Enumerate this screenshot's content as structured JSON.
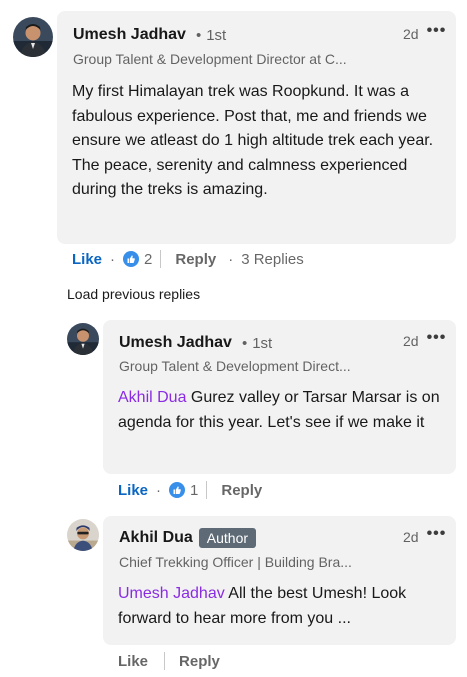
{
  "comments": [
    {
      "author": "Umesh Jadhav",
      "degree": "1st",
      "headline": "Group Talent & Development Director at C...",
      "time": "2d",
      "body": "My first Himalayan trek was Roopkund. It was a fabulous experience. Post that, me and friends we ensure we atleast do 1 high altitude trek each year. The peace, serenity and calmness experienced during the treks is amazing.",
      "like_label": "Like",
      "reaction_count": "2",
      "reply_label": "Reply",
      "replies_label": "3 Replies"
    },
    {
      "author": "Umesh Jadhav",
      "degree": "1st",
      "headline": "Group Talent & Development Direct...",
      "time": "2d",
      "mention": "Akhil Dua",
      "body": " Gurez valley or Tarsar Marsar is on agenda for this year. Let's see if we make it",
      "like_label": "Like",
      "reaction_count": "1",
      "reply_label": "Reply"
    },
    {
      "author": "Akhil Dua",
      "badge": "Author",
      "headline": "Chief Trekking Officer | Building Bra...",
      "time": "2d",
      "mention": "Umesh Jadhav",
      "body": " All the best Umesh! Look forward to hear more from you ...",
      "like_label": "Like",
      "reply_label": "Reply"
    }
  ],
  "load_previous": "Load previous replies",
  "more_glyph": "•••",
  "separator_dot": "·",
  "degree_dot": "•",
  "icons": {
    "reaction": "like-reaction-icon",
    "more": "more-options-icon"
  },
  "colors": {
    "like_blue": "#0a66c2",
    "mention_purple": "#8a2be2",
    "bubble_bg": "#f2f2f2",
    "badge_bg": "#5e6a76"
  }
}
